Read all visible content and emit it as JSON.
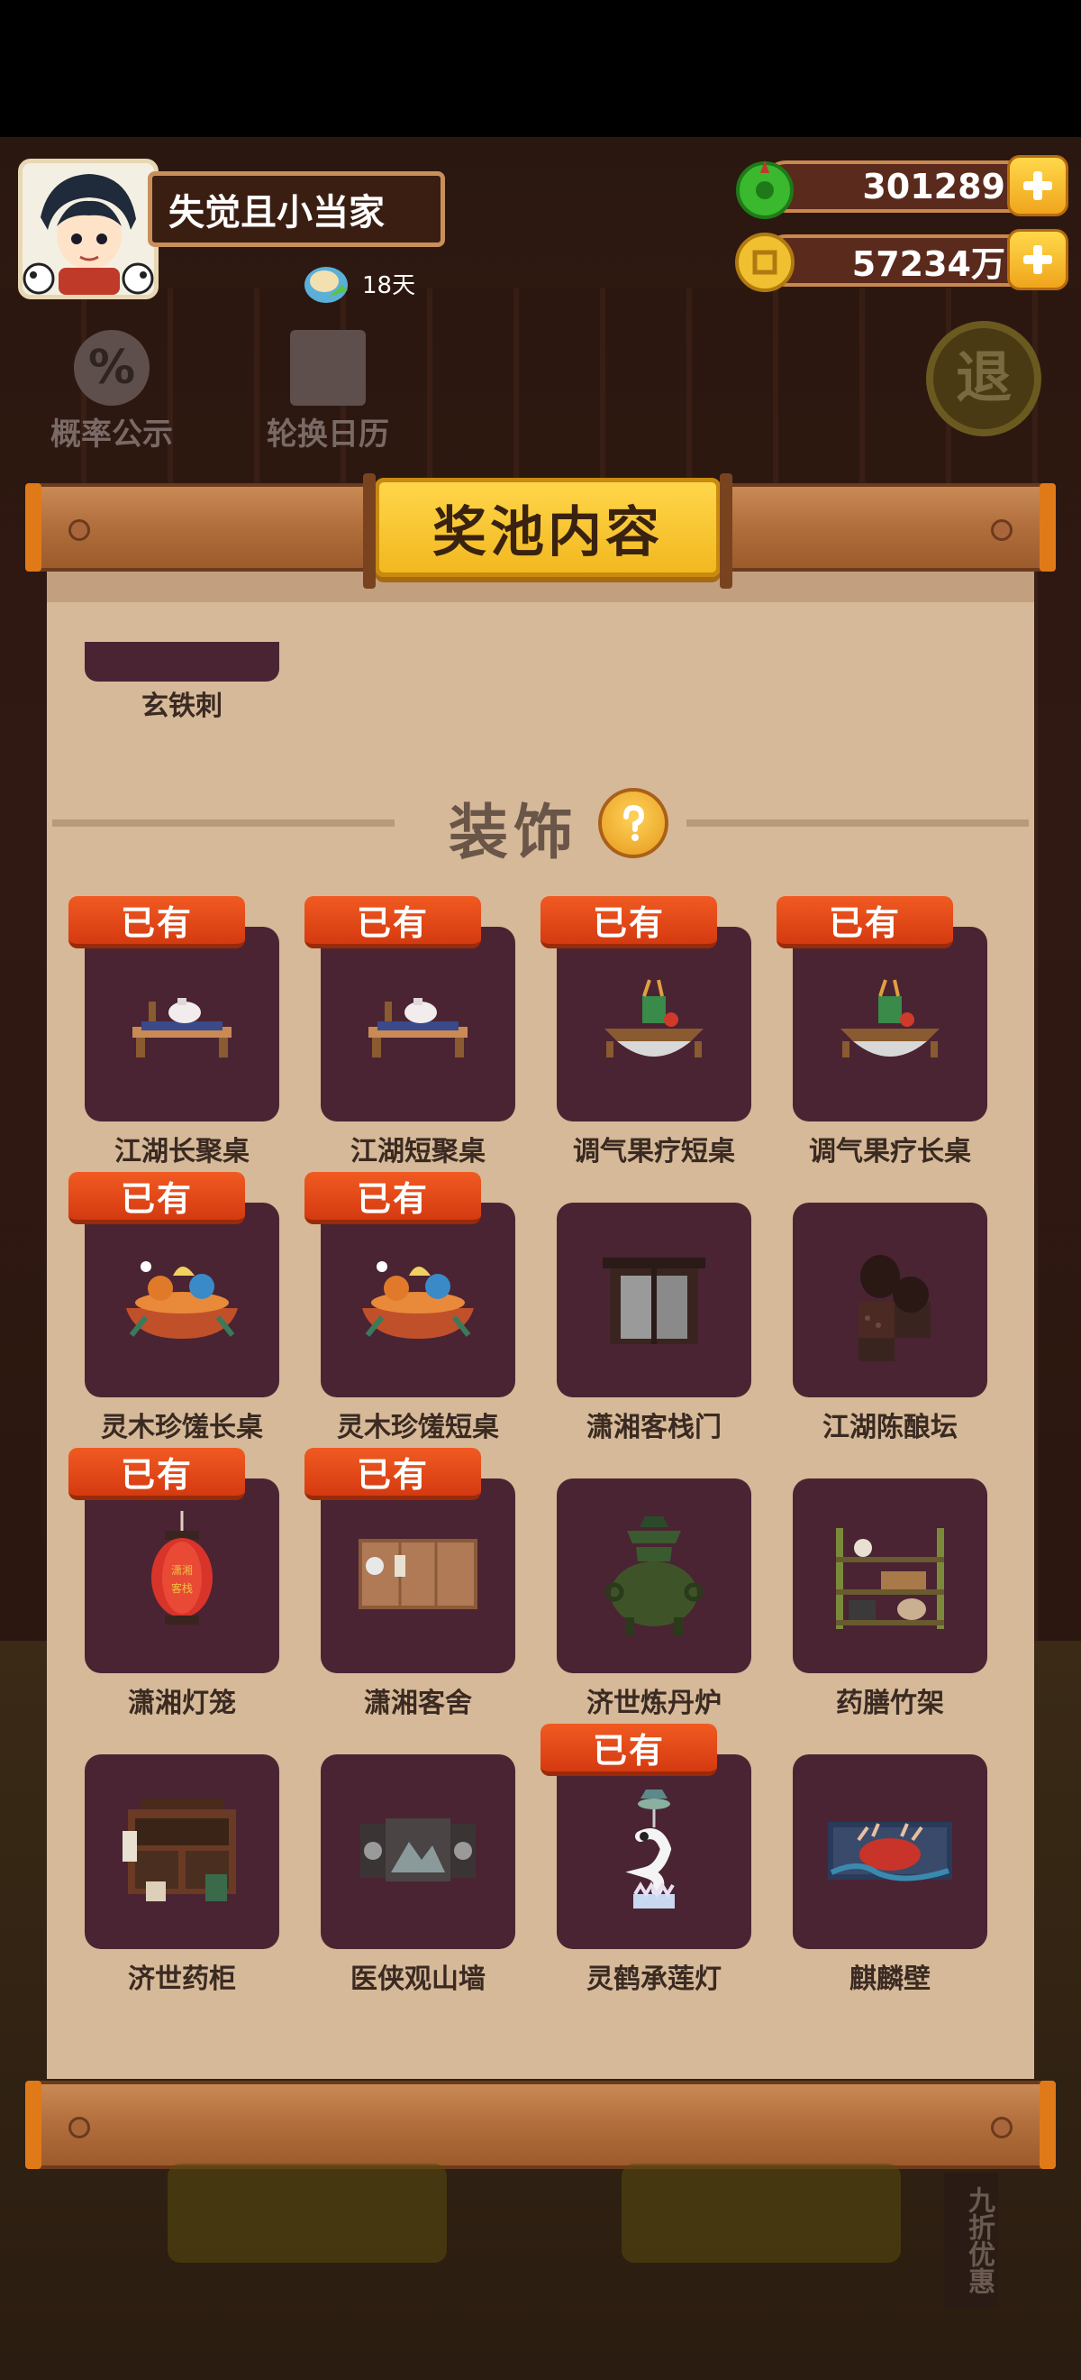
{
  "header": {
    "player_name": "失觉且小当家",
    "stamina_days": "18天",
    "resources": [
      {
        "icon": "jade-coin-icon",
        "value": "301289"
      },
      {
        "icon": "copper-coin-icon",
        "value": "57234万"
      }
    ]
  },
  "background": {
    "probability_label": "概率公示",
    "probability_icon_text": "%",
    "calendar_label": "轮换日历",
    "exit_label": "退",
    "discount_label": "九折优惠"
  },
  "modal": {
    "title": "奖池内容",
    "partial_item_label": "玄铁刺",
    "section_title": "装饰",
    "owned_badge": "已有",
    "items": [
      {
        "name": "江湖长聚桌",
        "owned": true,
        "icon": "tea-table-icon"
      },
      {
        "name": "江湖短聚桌",
        "owned": true,
        "icon": "tea-table-icon"
      },
      {
        "name": "调气果疗短桌",
        "owned": true,
        "icon": "fruit-table-icon"
      },
      {
        "name": "调气果疗长桌",
        "owned": true,
        "icon": "fruit-table-icon"
      },
      {
        "name": "灵木珍馐长桌",
        "owned": true,
        "icon": "feast-table-icon"
      },
      {
        "name": "灵木珍馐短桌",
        "owned": true,
        "icon": "feast-table-icon"
      },
      {
        "name": "潇湘客栈门",
        "owned": false,
        "icon": "inn-door-icon"
      },
      {
        "name": "江湖陈酿坛",
        "owned": false,
        "icon": "wine-jar-icon"
      },
      {
        "name": "潇湘灯笼",
        "owned": true,
        "icon": "lantern-icon"
      },
      {
        "name": "潇湘客舍",
        "owned": true,
        "icon": "guest-room-icon"
      },
      {
        "name": "济世炼丹炉",
        "owned": false,
        "icon": "alchemy-furnace-icon"
      },
      {
        "name": "药膳竹架",
        "owned": false,
        "icon": "bamboo-shelf-icon"
      },
      {
        "name": "济世药柜",
        "owned": false,
        "icon": "medicine-cabinet-icon"
      },
      {
        "name": "医侠观山墙",
        "owned": false,
        "icon": "mountain-wall-icon"
      },
      {
        "name": "灵鹤承莲灯",
        "owned": true,
        "icon": "crane-lotus-lamp-icon"
      },
      {
        "name": "麒麟壁",
        "owned": false,
        "icon": "qilin-wall-icon"
      }
    ],
    "lantern_text": "潇湘客栈"
  },
  "colors": {
    "panel": "#d6b998",
    "card": "#4a2433",
    "badge": "#e04a18",
    "title_plaque": "#f2b81f"
  }
}
